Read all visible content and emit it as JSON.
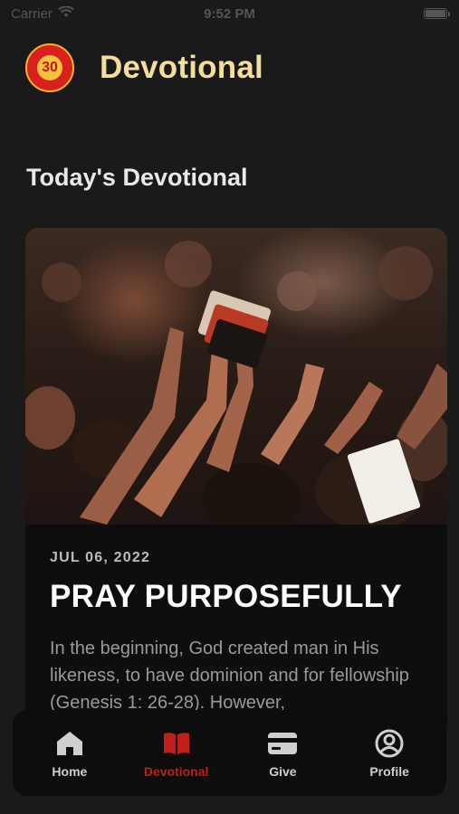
{
  "status_bar": {
    "carrier": "Carrier",
    "time": "9:52 PM"
  },
  "header": {
    "logo_text": "30",
    "title": "Devotional"
  },
  "section": {
    "title": "Today's Devotional"
  },
  "devotional_card": {
    "date": "JUL 06, 2022",
    "title": "PRAY PURPOSEFULLY",
    "excerpt": "In the beginning, God created man in His likeness, to have dominion and for fellowship (Genesis 1: 26-28). However,"
  },
  "tab_bar": {
    "tabs": [
      {
        "label": "Home",
        "icon": "home-icon",
        "active": false
      },
      {
        "label": "Devotional",
        "icon": "book-icon",
        "active": true
      },
      {
        "label": "Give",
        "icon": "card-icon",
        "active": false
      },
      {
        "label": "Profile",
        "icon": "profile-icon",
        "active": false
      }
    ]
  },
  "colors": {
    "background": "#1a1a1a",
    "title_accent": "#f4de9e",
    "active_tab": "#c21f1a",
    "inactive_tab": "#cfcfcf"
  }
}
